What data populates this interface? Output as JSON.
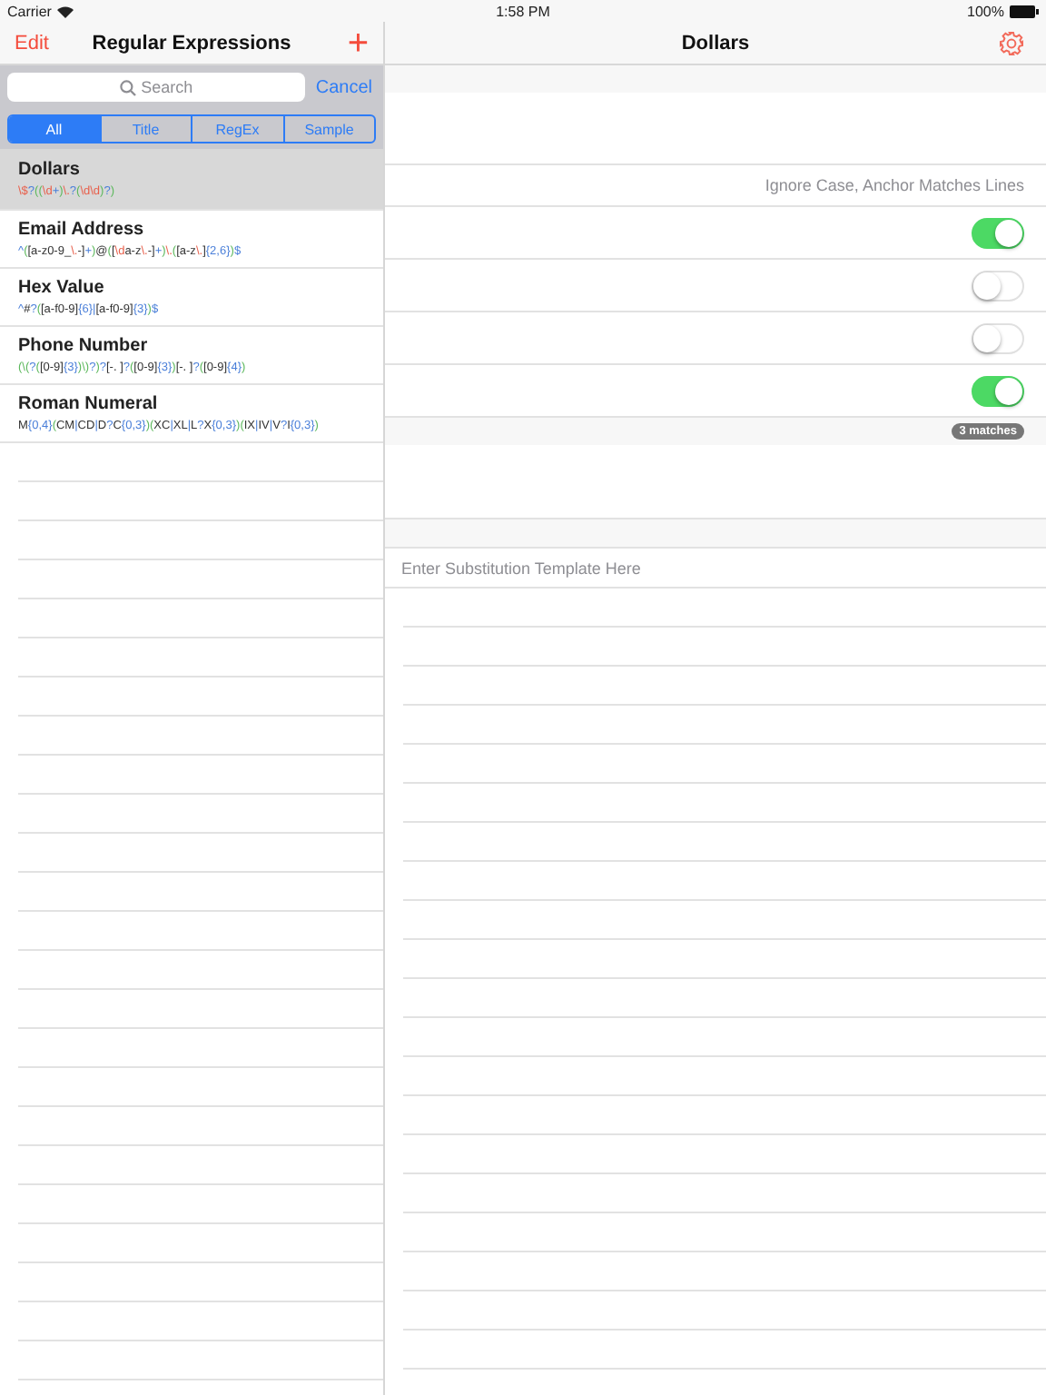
{
  "status_bar": {
    "carrier": "Carrier",
    "time": "1:58 PM",
    "battery": "100%"
  },
  "master": {
    "edit": "Edit",
    "title": "Regular Expressions",
    "add": "+",
    "search": {
      "placeholder": "Search",
      "cancel": "Cancel"
    },
    "scopes": [
      {
        "label": "All",
        "selected": true
      },
      {
        "label": "Title",
        "selected": false
      },
      {
        "label": "RegEx",
        "selected": false
      },
      {
        "label": "Sample",
        "selected": false
      }
    ],
    "items": [
      {
        "title": "Dollars",
        "selected": true,
        "pattern": [
          {
            "t": "\\$",
            "kind": "escape"
          },
          {
            "t": "?",
            "kind": "quantifier"
          },
          {
            "t": "((",
            "kind": "group"
          },
          {
            "t": "\\d",
            "kind": "escape"
          },
          {
            "t": "+",
            "kind": "quantifier"
          },
          {
            "t": ")",
            "kind": "group"
          },
          {
            "t": "\\.",
            "kind": "escape"
          },
          {
            "t": "?",
            "kind": "quantifier"
          },
          {
            "t": "(",
            "kind": "group"
          },
          {
            "t": "\\d\\d",
            "kind": "escape"
          },
          {
            "t": ")",
            "kind": "group"
          },
          {
            "t": "?",
            "kind": "quantifier"
          },
          {
            "t": ")",
            "kind": "group"
          }
        ]
      },
      {
        "title": "Email Address",
        "selected": false,
        "pattern": [
          {
            "t": "^",
            "kind": "quantifier"
          },
          {
            "t": "(",
            "kind": "group"
          },
          {
            "t": "[a-z0-9_",
            "kind": "literal"
          },
          {
            "t": "\\.",
            "kind": "escape"
          },
          {
            "t": "-]",
            "kind": "literal"
          },
          {
            "t": "+",
            "kind": "quantifier"
          },
          {
            "t": ")",
            "kind": "group"
          },
          {
            "t": "@",
            "kind": "literal"
          },
          {
            "t": "(",
            "kind": "group"
          },
          {
            "t": "[",
            "kind": "literal"
          },
          {
            "t": "\\d",
            "kind": "escape"
          },
          {
            "t": "a-z",
            "kind": "literal"
          },
          {
            "t": "\\.",
            "kind": "escape"
          },
          {
            "t": "-]",
            "kind": "literal"
          },
          {
            "t": "+",
            "kind": "quantifier"
          },
          {
            "t": ")",
            "kind": "group"
          },
          {
            "t": "\\.",
            "kind": "escape"
          },
          {
            "t": "(",
            "kind": "group"
          },
          {
            "t": "[a-z",
            "kind": "literal"
          },
          {
            "t": "\\.",
            "kind": "escape"
          },
          {
            "t": "]",
            "kind": "literal"
          },
          {
            "t": "{2,6}",
            "kind": "quantifier"
          },
          {
            "t": ")",
            "kind": "group"
          },
          {
            "t": "$",
            "kind": "quantifier"
          }
        ]
      },
      {
        "title": "Hex Value",
        "selected": false,
        "pattern": [
          {
            "t": "^",
            "kind": "quantifier"
          },
          {
            "t": "#",
            "kind": "literal"
          },
          {
            "t": "?",
            "kind": "quantifier"
          },
          {
            "t": "(",
            "kind": "group"
          },
          {
            "t": "[a-f0-9]",
            "kind": "literal"
          },
          {
            "t": "{6}|",
            "kind": "quantifier"
          },
          {
            "t": "[a-f0-9]",
            "kind": "literal"
          },
          {
            "t": "{3}",
            "kind": "quantifier"
          },
          {
            "t": ")",
            "kind": "group"
          },
          {
            "t": "$",
            "kind": "quantifier"
          }
        ]
      },
      {
        "title": "Phone Number",
        "selected": false,
        "pattern": [
          {
            "t": "(\\(",
            "kind": "group"
          },
          {
            "t": "?",
            "kind": "quantifier"
          },
          {
            "t": "(",
            "kind": "group"
          },
          {
            "t": "[0-9]",
            "kind": "literal"
          },
          {
            "t": "{3}",
            "kind": "quantifier"
          },
          {
            "t": ")\\)",
            "kind": "group"
          },
          {
            "t": "?",
            "kind": "quantifier"
          },
          {
            "t": ")",
            "kind": "group"
          },
          {
            "t": "?",
            "kind": "quantifier"
          },
          {
            "t": "[-. ]",
            "kind": "literal"
          },
          {
            "t": "?",
            "kind": "quantifier"
          },
          {
            "t": "(",
            "kind": "group"
          },
          {
            "t": "[0-9]",
            "kind": "literal"
          },
          {
            "t": "{3}",
            "kind": "quantifier"
          },
          {
            "t": ")",
            "kind": "group"
          },
          {
            "t": "[-. ]",
            "kind": "literal"
          },
          {
            "t": "?",
            "kind": "quantifier"
          },
          {
            "t": "(",
            "kind": "group"
          },
          {
            "t": "[0-9]",
            "kind": "literal"
          },
          {
            "t": "{4}",
            "kind": "quantifier"
          },
          {
            "t": ")",
            "kind": "group"
          }
        ]
      },
      {
        "title": "Roman Numeral",
        "selected": false,
        "pattern": [
          {
            "t": "M",
            "kind": "literal"
          },
          {
            "t": "{0,4}",
            "kind": "quantifier"
          },
          {
            "t": "(",
            "kind": "group"
          },
          {
            "t": "CM",
            "kind": "literal"
          },
          {
            "t": "|",
            "kind": "quantifier"
          },
          {
            "t": "CD",
            "kind": "literal"
          },
          {
            "t": "|",
            "kind": "quantifier"
          },
          {
            "t": "D",
            "kind": "literal"
          },
          {
            "t": "?",
            "kind": "quantifier"
          },
          {
            "t": "C",
            "kind": "literal"
          },
          {
            "t": "{0,3}",
            "kind": "quantifier"
          },
          {
            "t": ")(",
            "kind": "group"
          },
          {
            "t": "XC",
            "kind": "literal"
          },
          {
            "t": "|",
            "kind": "quantifier"
          },
          {
            "t": "XL",
            "kind": "literal"
          },
          {
            "t": "|",
            "kind": "quantifier"
          },
          {
            "t": "L",
            "kind": "literal"
          },
          {
            "t": "?",
            "kind": "quantifier"
          },
          {
            "t": "X",
            "kind": "literal"
          },
          {
            "t": "{0,3}",
            "kind": "quantifier"
          },
          {
            "t": ")(",
            "kind": "group"
          },
          {
            "t": "IX",
            "kind": "literal"
          },
          {
            "t": "|",
            "kind": "quantifier"
          },
          {
            "t": "IV",
            "kind": "literal"
          },
          {
            "t": "|",
            "kind": "quantifier"
          },
          {
            "t": "V",
            "kind": "literal"
          },
          {
            "t": "?",
            "kind": "quantifier"
          },
          {
            "t": "I",
            "kind": "literal"
          },
          {
            "t": "{0,3}",
            "kind": "quantifier"
          },
          {
            "t": ")",
            "kind": "group"
          }
        ]
      }
    ]
  },
  "detail": {
    "title": "Dollars",
    "options": "Ignore Case, Anchor Matches Lines",
    "switches": [
      {
        "on": true
      },
      {
        "on": false
      },
      {
        "on": false
      },
      {
        "on": true
      }
    ],
    "match_count": "3 matches",
    "template": {
      "placeholder": "Enter Substitution Template Here"
    }
  }
}
